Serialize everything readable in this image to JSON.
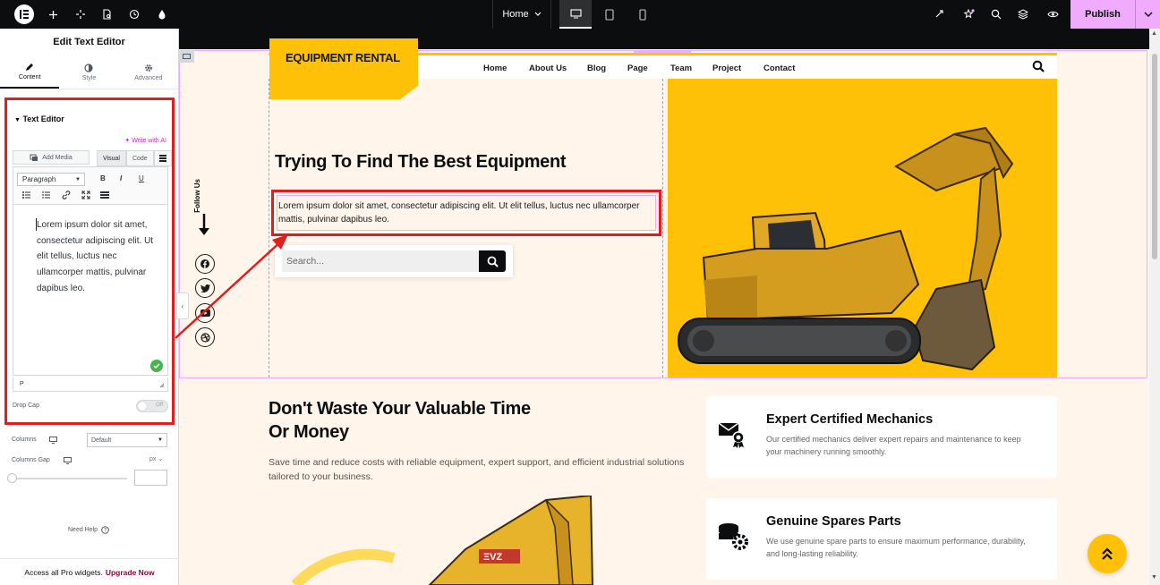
{
  "topbar": {
    "page_name": "Home",
    "publish_label": "Publish"
  },
  "panel": {
    "title": "Edit Text Editor",
    "tabs": [
      {
        "label": "Content",
        "icon": "pencil-icon"
      },
      {
        "label": "Style",
        "icon": "half-circle-icon"
      },
      {
        "label": "Advanced",
        "icon": "gear-icon"
      }
    ],
    "section_title": "Text Editor",
    "write_ai": "Write with AI",
    "add_media": "Add Media",
    "visual_tab": "Visual",
    "code_tab": "Code",
    "paragraph": "Paragraph",
    "editor_content": "Lorem ipsum dolor sit amet, consectetur adipiscing elit. Ut elit tellus, luctus nec ullamcorper mattis, pulvinar dapibus leo.",
    "path": "P",
    "drop_cap_label": "Drop Cap",
    "drop_cap_state": "Off",
    "columns_label": "Columns",
    "columns_value": "Default",
    "columns_gap_label": "Columns Gap",
    "columns_gap_unit": "px",
    "need_help": "Need Help",
    "upgrade_text": "Access all Pro widgets.",
    "upgrade_link": "Upgrade Now"
  },
  "site": {
    "brand": "EQUIPMENT RENTAL",
    "nav": [
      "Home",
      "About Us",
      "Blog",
      "Page",
      "Team",
      "Project",
      "Contact"
    ],
    "hero_title": "Trying To Find The Best Equipment",
    "hero_text": "Lorem ipsum dolor sit amet, consectetur adipiscing elit. Ut elit tellus, luctus nec ullamcorper mattis, pulvinar dapibus leo.",
    "search_placeholder": "Search...",
    "follow_us": "Follow Us",
    "social": [
      "facebook-icon",
      "twitter-icon",
      "youtube-icon",
      "dribbble-icon"
    ],
    "section2_title": "Don't Waste Your Valuable Time Or Money",
    "section2_text": "Save time and reduce costs with reliable equipment, expert support, and efficient industrial solutions tailored to your business.",
    "features": [
      {
        "title": "Expert Certified Mechanics",
        "desc": "Our certified mechanics deliver expert repairs and maintenance to keep your machinery running smoothly.",
        "icon": "certified-mechanic-icon"
      },
      {
        "title": "Genuine Spares Parts",
        "desc": "We use genuine spare parts to ensure maximum performance, durability, and long-lasting reliability.",
        "icon": "spare-parts-icon"
      }
    ]
  },
  "colors": {
    "accent": "#ffc107",
    "editor_accent": "#f0abfc",
    "annotation": "#e11d1d"
  }
}
